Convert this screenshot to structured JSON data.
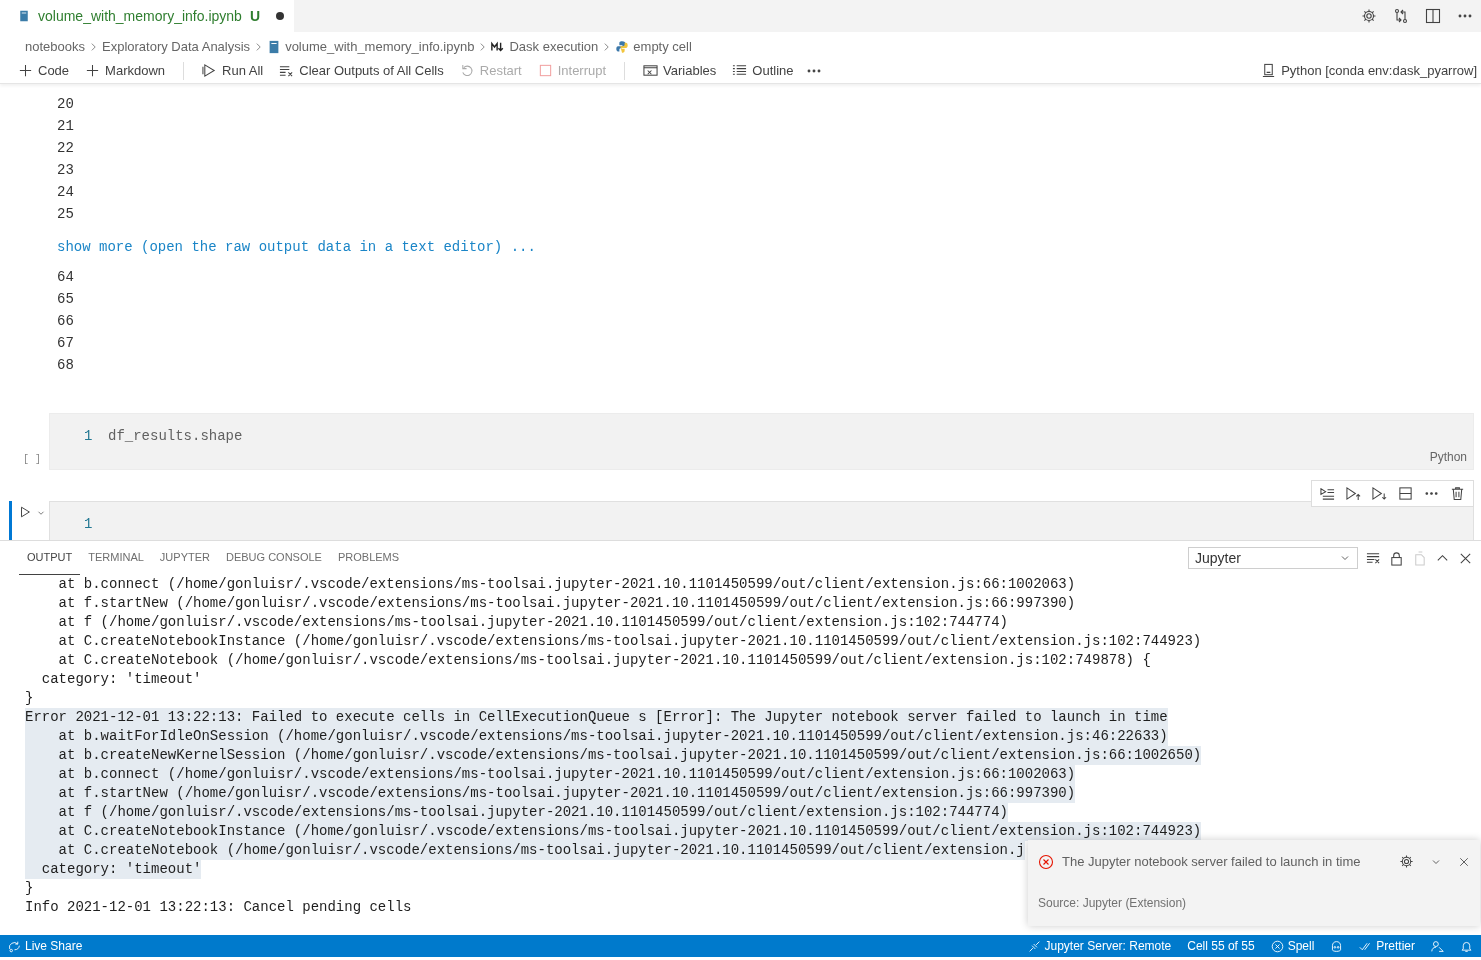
{
  "tab": {
    "title": "volume_with_memory_info.ipynb",
    "badge": "U",
    "dirty": true
  },
  "breadcrumbs": [
    {
      "label": "notebooks",
      "kind": "folder"
    },
    {
      "label": "Exploratory Data Analysis",
      "kind": "folder"
    },
    {
      "label": "volume_with_memory_info.ipynb",
      "kind": "notebook"
    },
    {
      "label": "Dask execution",
      "kind": "markdown"
    },
    {
      "label": "empty cell",
      "kind": "python"
    }
  ],
  "toolbar": [
    {
      "label": "Code",
      "kind": "add",
      "disabled": false
    },
    {
      "label": "Markdown",
      "kind": "add",
      "disabled": false
    },
    {
      "label": "Run All",
      "kind": "runall",
      "disabled": false
    },
    {
      "label": "Clear Outputs of All Cells",
      "kind": "clear",
      "disabled": false
    },
    {
      "label": "Restart",
      "kind": "restart",
      "disabled": true
    },
    {
      "label": "Interrupt",
      "kind": "interrupt",
      "disabled": true
    },
    {
      "label": "Variables",
      "kind": "variables",
      "disabled": false
    },
    {
      "label": "Outline",
      "kind": "outline",
      "disabled": false
    }
  ],
  "kernel": "Python [conda env:dask_pyarrow]",
  "output": {
    "lines_before": [
      "20",
      "21",
      "22",
      "23",
      "24",
      "25"
    ],
    "show_more": "show more (open the raw output data in a text editor) ...",
    "lines_after": [
      "64",
      "65",
      "66",
      "67",
      "68"
    ]
  },
  "cells": [
    {
      "line": "1",
      "code": "df_results.shape",
      "execution": "[ ]",
      "language": "Python",
      "selected": false
    },
    {
      "line": "1",
      "selected": true
    }
  ],
  "panel": {
    "tabs": [
      {
        "label": "OUTPUT",
        "selected": true
      },
      {
        "label": "TERMINAL",
        "selected": false
      },
      {
        "label": "JUPYTER",
        "selected": false
      },
      {
        "label": "DEBUG CONSOLE",
        "selected": false
      },
      {
        "label": "PROBLEMS",
        "selected": false
      }
    ],
    "channel": "Jupyter",
    "lines": [
      {
        "text": "    at b.connect (/home/gonluisr/.vscode/extensions/ms-toolsai.jupyter-2021.10.1101450599/out/client/extension.js:66:1002063)",
        "selected": false
      },
      {
        "text": "    at f.startNew (/home/gonluisr/.vscode/extensions/ms-toolsai.jupyter-2021.10.1101450599/out/client/extension.js:66:997390)",
        "selected": false
      },
      {
        "text": "    at f (/home/gonluisr/.vscode/extensions/ms-toolsai.jupyter-2021.10.1101450599/out/client/extension.js:102:744774)",
        "selected": false
      },
      {
        "text": "    at C.createNotebookInstance (/home/gonluisr/.vscode/extensions/ms-toolsai.jupyter-2021.10.1101450599/out/client/extension.js:102:744923)",
        "selected": false
      },
      {
        "text": "    at C.createNotebook (/home/gonluisr/.vscode/extensions/ms-toolsai.jupyter-2021.10.1101450599/out/client/extension.js:102:749878) {",
        "selected": false
      },
      {
        "text": "  category: 'timeout'",
        "selected": false
      },
      {
        "text": "}",
        "selected": false
      },
      {
        "text": "Error 2021-12-01 13:22:13: Failed to execute cells in CellExecutionQueue s [Error]: The Jupyter notebook server failed to launch in time",
        "selected": true
      },
      {
        "text": "    at b.waitForIdleOnSession (/home/gonluisr/.vscode/extensions/ms-toolsai.jupyter-2021.10.1101450599/out/client/extension.js:46:22633)",
        "selected": true
      },
      {
        "text": "    at b.createNewKernelSession (/home/gonluisr/.vscode/extensions/ms-toolsai.jupyter-2021.10.1101450599/out/client/extension.js:66:1002650)",
        "selected": true
      },
      {
        "text": "    at b.connect (/home/gonluisr/.vscode/extensions/ms-toolsai.jupyter-2021.10.1101450599/out/client/extension.js:66:1002063)",
        "selected": true
      },
      {
        "text": "    at f.startNew (/home/gonluisr/.vscode/extensions/ms-toolsai.jupyter-2021.10.1101450599/out/client/extension.js:66:997390)",
        "selected": true
      },
      {
        "text": "    at f (/home/gonluisr/.vscode/extensions/ms-toolsai.jupyter-2021.10.1101450599/out/client/extension.js:102:744774)",
        "selected": true
      },
      {
        "text": "    at C.createNotebookInstance (/home/gonluisr/.vscode/extensions/ms-toolsai.jupyter-2021.10.1101450599/out/client/extension.js:102:744923)",
        "selected": true
      },
      {
        "text": "    at C.createNotebook (/home/gonluisr/.vscode/extensions/ms-toolsai.jupyter-2021.10.1101450599/out/client/extension.j",
        "selected": true
      },
      {
        "text": "  category: 'timeout'",
        "selected": true
      },
      {
        "text": "}",
        "selected": false
      },
      {
        "text": "Info 2021-12-01 13:22:13: Cancel pending cells",
        "selected": false
      }
    ]
  },
  "notification": {
    "message": "The Jupyter notebook server failed to launch in time",
    "source": "Source: Jupyter (Extension)"
  },
  "status_bar": {
    "left": [
      {
        "label": "Live Share",
        "kind": "share"
      }
    ],
    "right": [
      {
        "label": "Jupyter Server: Remote",
        "kind": "server"
      },
      {
        "label": "Cell 55 of 55",
        "kind": "text"
      },
      {
        "label": "Spell",
        "kind": "spell"
      },
      {
        "kind": "copilot"
      },
      {
        "label": "Prettier",
        "kind": "prettier"
      },
      {
        "kind": "feedback"
      },
      {
        "kind": "bell"
      }
    ]
  }
}
